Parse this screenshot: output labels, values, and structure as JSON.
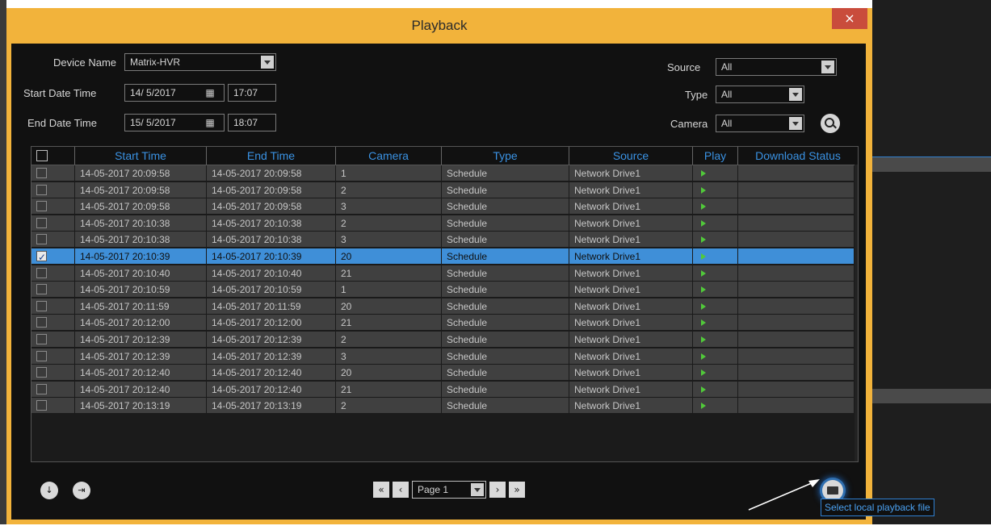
{
  "window": {
    "title": "Playback",
    "close_glyph": "×"
  },
  "filters": {
    "device_name_label": "Device Name",
    "device_name_value": "Matrix-HVR",
    "start_label": "Start Date Time",
    "start_date": "14/ 5/2017",
    "start_time": "17:07",
    "end_label": "End Date Time",
    "end_date": "15/ 5/2017",
    "end_time": "18:07",
    "source_label": "Source",
    "source_value": "All",
    "type_label": "Type",
    "type_value": "All",
    "camera_label": "Camera",
    "camera_value": "All"
  },
  "table": {
    "headers": [
      "Start Time",
      "End Time",
      "Camera",
      "Type",
      "Source",
      "Play",
      "Download Status"
    ],
    "rows": [
      {
        "start": "14-05-2017 20:09:58",
        "end": "14-05-2017 20:09:58",
        "camera": "1",
        "type": "Schedule",
        "source": "Network Drive1",
        "status": "",
        "selected": false
      },
      {
        "start": "14-05-2017 20:09:58",
        "end": "14-05-2017 20:09:58",
        "camera": "2",
        "type": "Schedule",
        "source": "Network Drive1",
        "status": "",
        "selected": false
      },
      {
        "start": "14-05-2017 20:09:58",
        "end": "14-05-2017 20:09:58",
        "camera": "3",
        "type": "Schedule",
        "source": "Network Drive1",
        "status": "",
        "selected": false
      },
      {
        "start": "14-05-2017 20:10:38",
        "end": "14-05-2017 20:10:38",
        "camera": "2",
        "type": "Schedule",
        "source": "Network Drive1",
        "status": "",
        "selected": false
      },
      {
        "start": "14-05-2017 20:10:38",
        "end": "14-05-2017 20:10:38",
        "camera": "3",
        "type": "Schedule",
        "source": "Network Drive1",
        "status": "",
        "selected": false
      },
      {
        "start": "14-05-2017 20:10:39",
        "end": "14-05-2017 20:10:39",
        "camera": "20",
        "type": "Schedule",
        "source": "Network Drive1",
        "status": "",
        "selected": true
      },
      {
        "start": "14-05-2017 20:10:40",
        "end": "14-05-2017 20:10:40",
        "camera": "21",
        "type": "Schedule",
        "source": "Network Drive1",
        "status": "",
        "selected": false
      },
      {
        "start": "14-05-2017 20:10:59",
        "end": "14-05-2017 20:10:59",
        "camera": "1",
        "type": "Schedule",
        "source": "Network Drive1",
        "status": "",
        "selected": false
      },
      {
        "start": "14-05-2017 20:11:59",
        "end": "14-05-2017 20:11:59",
        "camera": "20",
        "type": "Schedule",
        "source": "Network Drive1",
        "status": "",
        "selected": false
      },
      {
        "start": "14-05-2017 20:12:00",
        "end": "14-05-2017 20:12:00",
        "camera": "21",
        "type": "Schedule",
        "source": "Network Drive1",
        "status": "",
        "selected": false
      },
      {
        "start": "14-05-2017 20:12:39",
        "end": "14-05-2017 20:12:39",
        "camera": "2",
        "type": "Schedule",
        "source": "Network Drive1",
        "status": "",
        "selected": false
      },
      {
        "start": "14-05-2017 20:12:39",
        "end": "14-05-2017 20:12:39",
        "camera": "3",
        "type": "Schedule",
        "source": "Network Drive1",
        "status": "",
        "selected": false
      },
      {
        "start": "14-05-2017 20:12:40",
        "end": "14-05-2017 20:12:40",
        "camera": "20",
        "type": "Schedule",
        "source": "Network Drive1",
        "status": "",
        "selected": false
      },
      {
        "start": "14-05-2017 20:12:40",
        "end": "14-05-2017 20:12:40",
        "camera": "21",
        "type": "Schedule",
        "source": "Network Drive1",
        "status": "",
        "selected": false
      },
      {
        "start": "14-05-2017 20:13:19",
        "end": "14-05-2017 20:13:19",
        "camera": "2",
        "type": "Schedule",
        "source": "Network Drive1",
        "status": "",
        "selected": false
      }
    ]
  },
  "pagination": {
    "first_glyph": "«",
    "prev_glyph": "‹",
    "page_value": "Page 1",
    "next_glyph": "›",
    "last_glyph": "»"
  },
  "footer": {
    "download_icon_glyph": "↓",
    "export_icon_glyph": "⇥",
    "tooltip": "Select local playback file"
  },
  "colors": {
    "window_frame": "#f2b33b",
    "background": "#111111",
    "header_text": "#3a92e3",
    "row_bg": "#404040",
    "selected_row": "#3f8fd8",
    "play_icon": "#51c93a",
    "close_button": "#c94c3c"
  },
  "icons": [
    "close-icon",
    "calendar-icon",
    "dropdown-arrow-icon",
    "search-icon",
    "play-icon",
    "download-icon",
    "export-icon",
    "first-page-icon",
    "prev-page-icon",
    "next-page-icon",
    "last-page-icon",
    "folder-icon"
  ]
}
